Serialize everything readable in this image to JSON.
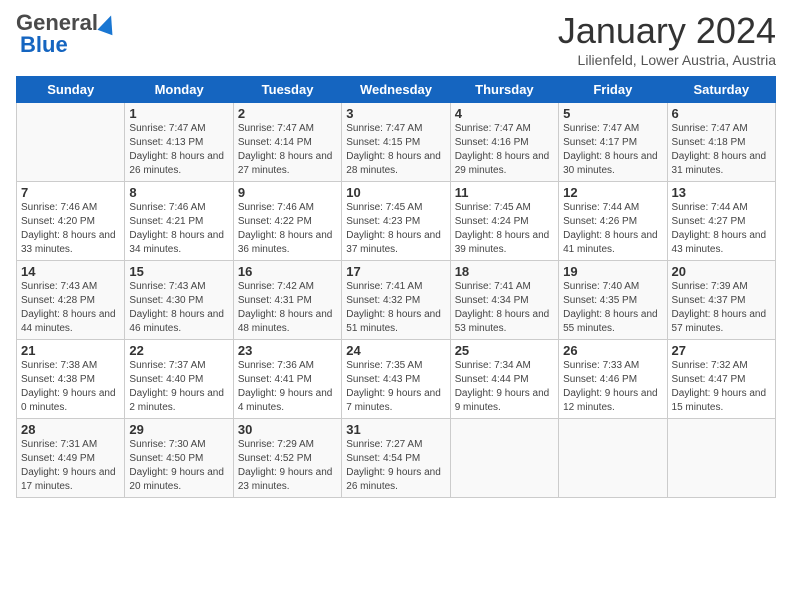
{
  "header": {
    "logo_general": "General",
    "logo_blue": "Blue",
    "month_title": "January 2024",
    "location": "Lilienfeld, Lower Austria, Austria"
  },
  "days_of_week": [
    "Sunday",
    "Monday",
    "Tuesday",
    "Wednesday",
    "Thursday",
    "Friday",
    "Saturday"
  ],
  "weeks": [
    [
      {
        "day": "",
        "sunrise": "",
        "sunset": "",
        "daylight": ""
      },
      {
        "day": "1",
        "sunrise": "Sunrise: 7:47 AM",
        "sunset": "Sunset: 4:13 PM",
        "daylight": "Daylight: 8 hours and 26 minutes."
      },
      {
        "day": "2",
        "sunrise": "Sunrise: 7:47 AM",
        "sunset": "Sunset: 4:14 PM",
        "daylight": "Daylight: 8 hours and 27 minutes."
      },
      {
        "day": "3",
        "sunrise": "Sunrise: 7:47 AM",
        "sunset": "Sunset: 4:15 PM",
        "daylight": "Daylight: 8 hours and 28 minutes."
      },
      {
        "day": "4",
        "sunrise": "Sunrise: 7:47 AM",
        "sunset": "Sunset: 4:16 PM",
        "daylight": "Daylight: 8 hours and 29 minutes."
      },
      {
        "day": "5",
        "sunrise": "Sunrise: 7:47 AM",
        "sunset": "Sunset: 4:17 PM",
        "daylight": "Daylight: 8 hours and 30 minutes."
      },
      {
        "day": "6",
        "sunrise": "Sunrise: 7:47 AM",
        "sunset": "Sunset: 4:18 PM",
        "daylight": "Daylight: 8 hours and 31 minutes."
      }
    ],
    [
      {
        "day": "7",
        "sunrise": "Sunrise: 7:46 AM",
        "sunset": "Sunset: 4:20 PM",
        "daylight": "Daylight: 8 hours and 33 minutes."
      },
      {
        "day": "8",
        "sunrise": "Sunrise: 7:46 AM",
        "sunset": "Sunset: 4:21 PM",
        "daylight": "Daylight: 8 hours and 34 minutes."
      },
      {
        "day": "9",
        "sunrise": "Sunrise: 7:46 AM",
        "sunset": "Sunset: 4:22 PM",
        "daylight": "Daylight: 8 hours and 36 minutes."
      },
      {
        "day": "10",
        "sunrise": "Sunrise: 7:45 AM",
        "sunset": "Sunset: 4:23 PM",
        "daylight": "Daylight: 8 hours and 37 minutes."
      },
      {
        "day": "11",
        "sunrise": "Sunrise: 7:45 AM",
        "sunset": "Sunset: 4:24 PM",
        "daylight": "Daylight: 8 hours and 39 minutes."
      },
      {
        "day": "12",
        "sunrise": "Sunrise: 7:44 AM",
        "sunset": "Sunset: 4:26 PM",
        "daylight": "Daylight: 8 hours and 41 minutes."
      },
      {
        "day": "13",
        "sunrise": "Sunrise: 7:44 AM",
        "sunset": "Sunset: 4:27 PM",
        "daylight": "Daylight: 8 hours and 43 minutes."
      }
    ],
    [
      {
        "day": "14",
        "sunrise": "Sunrise: 7:43 AM",
        "sunset": "Sunset: 4:28 PM",
        "daylight": "Daylight: 8 hours and 44 minutes."
      },
      {
        "day": "15",
        "sunrise": "Sunrise: 7:43 AM",
        "sunset": "Sunset: 4:30 PM",
        "daylight": "Daylight: 8 hours and 46 minutes."
      },
      {
        "day": "16",
        "sunrise": "Sunrise: 7:42 AM",
        "sunset": "Sunset: 4:31 PM",
        "daylight": "Daylight: 8 hours and 48 minutes."
      },
      {
        "day": "17",
        "sunrise": "Sunrise: 7:41 AM",
        "sunset": "Sunset: 4:32 PM",
        "daylight": "Daylight: 8 hours and 51 minutes."
      },
      {
        "day": "18",
        "sunrise": "Sunrise: 7:41 AM",
        "sunset": "Sunset: 4:34 PM",
        "daylight": "Daylight: 8 hours and 53 minutes."
      },
      {
        "day": "19",
        "sunrise": "Sunrise: 7:40 AM",
        "sunset": "Sunset: 4:35 PM",
        "daylight": "Daylight: 8 hours and 55 minutes."
      },
      {
        "day": "20",
        "sunrise": "Sunrise: 7:39 AM",
        "sunset": "Sunset: 4:37 PM",
        "daylight": "Daylight: 8 hours and 57 minutes."
      }
    ],
    [
      {
        "day": "21",
        "sunrise": "Sunrise: 7:38 AM",
        "sunset": "Sunset: 4:38 PM",
        "daylight": "Daylight: 9 hours and 0 minutes."
      },
      {
        "day": "22",
        "sunrise": "Sunrise: 7:37 AM",
        "sunset": "Sunset: 4:40 PM",
        "daylight": "Daylight: 9 hours and 2 minutes."
      },
      {
        "day": "23",
        "sunrise": "Sunrise: 7:36 AM",
        "sunset": "Sunset: 4:41 PM",
        "daylight": "Daylight: 9 hours and 4 minutes."
      },
      {
        "day": "24",
        "sunrise": "Sunrise: 7:35 AM",
        "sunset": "Sunset: 4:43 PM",
        "daylight": "Daylight: 9 hours and 7 minutes."
      },
      {
        "day": "25",
        "sunrise": "Sunrise: 7:34 AM",
        "sunset": "Sunset: 4:44 PM",
        "daylight": "Daylight: 9 hours and 9 minutes."
      },
      {
        "day": "26",
        "sunrise": "Sunrise: 7:33 AM",
        "sunset": "Sunset: 4:46 PM",
        "daylight": "Daylight: 9 hours and 12 minutes."
      },
      {
        "day": "27",
        "sunrise": "Sunrise: 7:32 AM",
        "sunset": "Sunset: 4:47 PM",
        "daylight": "Daylight: 9 hours and 15 minutes."
      }
    ],
    [
      {
        "day": "28",
        "sunrise": "Sunrise: 7:31 AM",
        "sunset": "Sunset: 4:49 PM",
        "daylight": "Daylight: 9 hours and 17 minutes."
      },
      {
        "day": "29",
        "sunrise": "Sunrise: 7:30 AM",
        "sunset": "Sunset: 4:50 PM",
        "daylight": "Daylight: 9 hours and 20 minutes."
      },
      {
        "day": "30",
        "sunrise": "Sunrise: 7:29 AM",
        "sunset": "Sunset: 4:52 PM",
        "daylight": "Daylight: 9 hours and 23 minutes."
      },
      {
        "day": "31",
        "sunrise": "Sunrise: 7:27 AM",
        "sunset": "Sunset: 4:54 PM",
        "daylight": "Daylight: 9 hours and 26 minutes."
      },
      {
        "day": "",
        "sunrise": "",
        "sunset": "",
        "daylight": ""
      },
      {
        "day": "",
        "sunrise": "",
        "sunset": "",
        "daylight": ""
      },
      {
        "day": "",
        "sunrise": "",
        "sunset": "",
        "daylight": ""
      }
    ]
  ]
}
